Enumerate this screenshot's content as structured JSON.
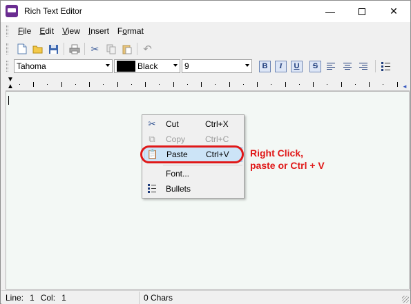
{
  "window": {
    "title": "Rich Text Editor"
  },
  "menubar": {
    "items": [
      "File",
      "Edit",
      "View",
      "Insert",
      "Format"
    ],
    "mnemonics": [
      "F",
      "E",
      "V",
      "I",
      "o"
    ]
  },
  "format_bar": {
    "font": "Tahoma",
    "color_name": "Black",
    "color_value": "#000000",
    "size": "9",
    "bold": "B",
    "italic": "I",
    "underline": "U",
    "strike": "S"
  },
  "context_menu": {
    "items": [
      {
        "label": "Cut",
        "shortcut": "Ctrl+X",
        "icon": "scissors-icon",
        "enabled": true
      },
      {
        "label": "Copy",
        "shortcut": "Ctrl+C",
        "icon": "copy-icon",
        "enabled": false
      },
      {
        "label": "Paste",
        "shortcut": "Ctrl+V",
        "icon": "paste-icon",
        "enabled": true,
        "highlighted": true
      },
      {
        "label": "Font...",
        "shortcut": "",
        "icon": "",
        "enabled": true
      },
      {
        "label": "Bullets",
        "shortcut": "",
        "icon": "bullets-icon",
        "enabled": true
      }
    ]
  },
  "annotation": {
    "line1": "Right Click,",
    "line2": "paste or Ctrl + V",
    "color": "#e01818"
  },
  "statusbar": {
    "line_label": "Line:",
    "line": "1",
    "col_label": "Col:",
    "col": "1",
    "chars": "0 Chars"
  }
}
